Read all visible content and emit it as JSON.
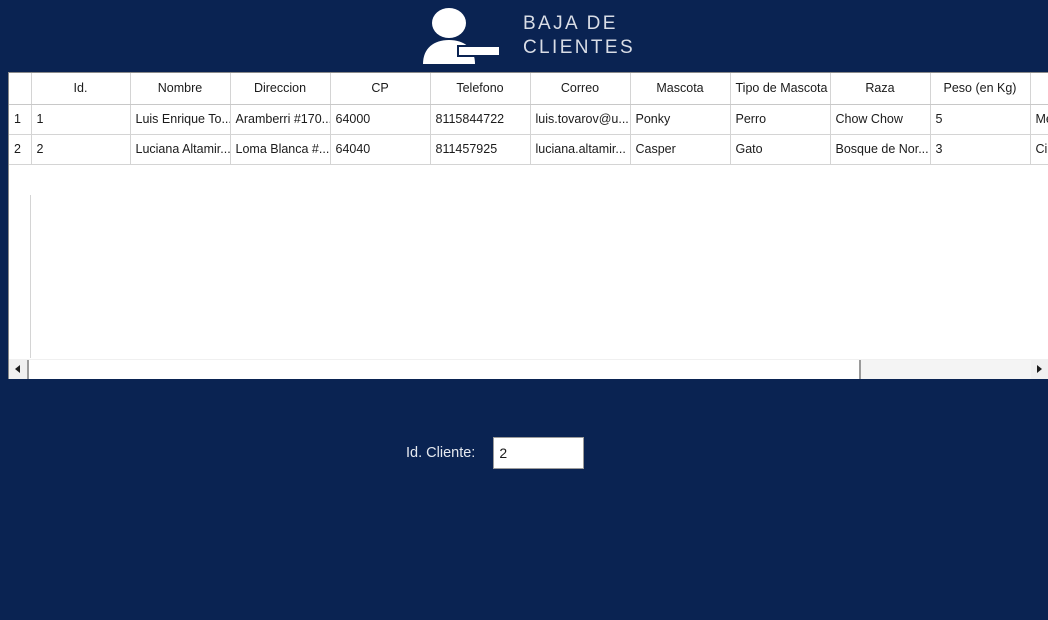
{
  "app": {
    "background_color": "#0a2352",
    "title_line1": "BAJA DE",
    "title_line2": "CLIENTES",
    "title": "BAJA DE\nCLIENTES",
    "icon_name": "remove-user-icon"
  },
  "grid": {
    "columns": [
      {
        "key": "rowhdr",
        "label": ""
      },
      {
        "key": "id",
        "label": "Id."
      },
      {
        "key": "nombre",
        "label": "Nombre"
      },
      {
        "key": "direccion",
        "label": "Direccion"
      },
      {
        "key": "cp",
        "label": "CP"
      },
      {
        "key": "telefono",
        "label": "Telefono"
      },
      {
        "key": "correo",
        "label": "Correo"
      },
      {
        "key": "mascota",
        "label": "Mascota"
      },
      {
        "key": "tipo_mascota",
        "label": "Tipo de Mascota"
      },
      {
        "key": "raza",
        "label": "Raza"
      },
      {
        "key": "peso",
        "label": "Peso (en Kg)"
      },
      {
        "key": "extra",
        "label": ""
      },
      {
        "key": "extra2",
        "label": ""
      }
    ],
    "rows": [
      {
        "rowhdr": "1",
        "id": "1",
        "nombre": "Luis Enrique To...",
        "direccion": "Aramberri #170...",
        "cp": "64000",
        "telefono": "8115844722",
        "correo": "luis.tovarov@u...",
        "mascota": "Ponky",
        "tipo_mascota": "Perro",
        "raza": "Chow Chow",
        "peso": "5",
        "extra": "Med",
        "extra2": ""
      },
      {
        "rowhdr": "2",
        "id": "2",
        "nombre": "Luciana Altamir...",
        "direccion": "Loma Blanca #...",
        "cp": "64040",
        "telefono": "811457925",
        "correo": "luciana.altamir...",
        "mascota": "Casper",
        "tipo_mascota": "Gato",
        "raza": "Bosque de Nor...",
        "peso": "3",
        "extra": "Ciru",
        "extra2": ""
      }
    ],
    "scrollbar": {
      "left_arrow_icon": "triangle-left-icon",
      "right_arrow_icon": "triangle-right-icon"
    }
  },
  "form": {
    "id_cliente_label": "Id. Cliente:",
    "id_cliente_value": "2",
    "id_cliente_placeholder": ""
  }
}
